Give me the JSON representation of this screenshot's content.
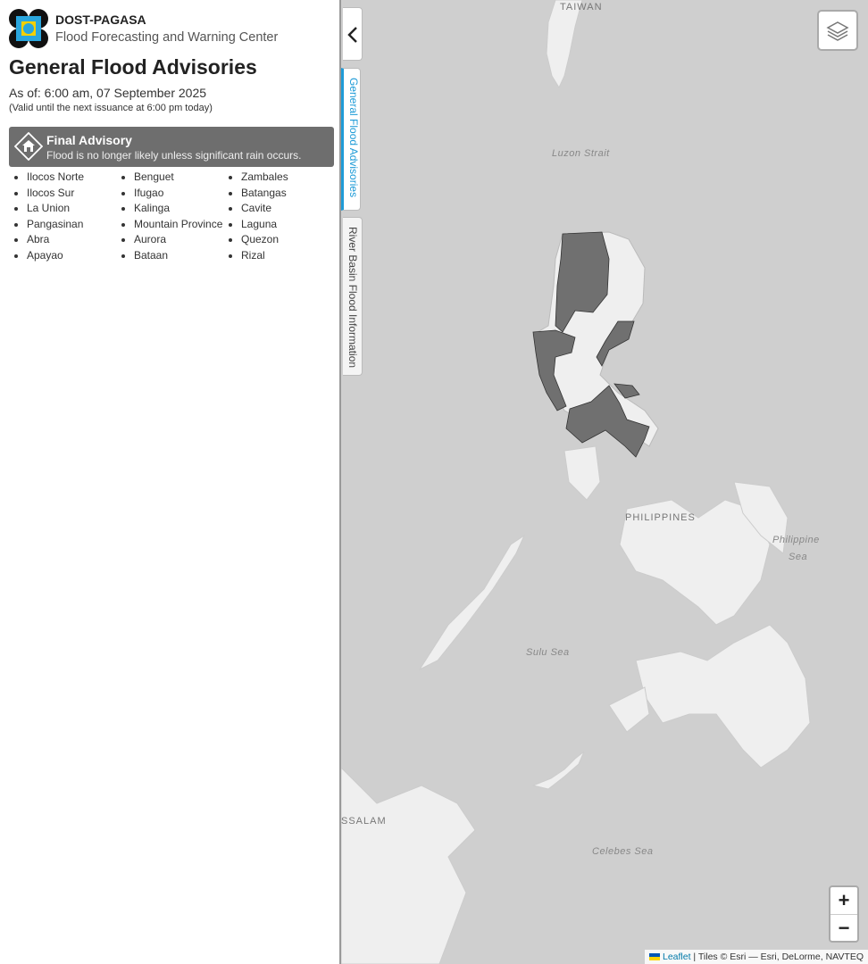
{
  "brand": {
    "org": "DOST-PAGASA",
    "center": "Flood Forecasting and Warning Center"
  },
  "page_title": "General Flood Advisories",
  "as_of": "As of: 6:00 am, 07 September 2025",
  "valid_until": "(Valid until the next issuance at 6:00 pm today)",
  "advisory": {
    "title": "Final Advisory",
    "description": "Flood is no longer likely unless significant rain occurs.",
    "color": "#6e6e6e",
    "icon": "house-warning-icon"
  },
  "provinces": [
    "Ilocos Norte",
    "Ilocos Sur",
    "La Union",
    "Pangasinan",
    "Abra",
    "Apayao",
    "Benguet",
    "Ifugao",
    "Kalinga",
    "Mountain Province",
    "Aurora",
    "Bataan",
    "Zambales",
    "Batangas",
    "Cavite",
    "Laguna",
    "Quezon",
    "Rizal"
  ],
  "tabs": [
    {
      "label": "General Flood Advisories",
      "active": true
    },
    {
      "label": "River Basin Flood Information",
      "active": false
    }
  ],
  "map": {
    "labels": {
      "taiwan": "TAIWAN",
      "luzon_strait": "Luzon Strait",
      "philippines": "PHILIPPINES",
      "philippine_sea_1": "Philippine",
      "philippine_sea_2": "Sea",
      "sulu_sea": "Sulu Sea",
      "brunei": "SSALAM",
      "celebes_sea": "Celebes Sea"
    },
    "zoom_in": "+",
    "zoom_out": "−",
    "attribution_leaflet": "Leaflet",
    "attribution_rest": " | Tiles © Esri — Esri, DeLorme, NAVTEQ",
    "colors": {
      "water": "#cfcfcf",
      "land": "#efefef",
      "advisory_fill": "#707070"
    }
  }
}
